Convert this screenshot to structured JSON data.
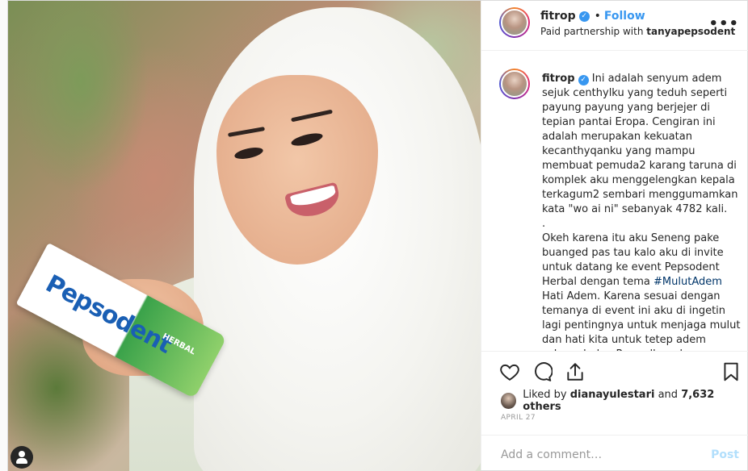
{
  "header": {
    "username": "fitrop",
    "follow_label": "Follow",
    "partnership_prefix": "Paid partnership with",
    "partner": "tanyapepsodent",
    "more_glyph": "•••"
  },
  "photo": {
    "product_brand": "Pepsodent",
    "product_variant": "HERBAL"
  },
  "caption": {
    "username": "fitrop",
    "text_1": "Ini adalah senyum adem sejuk centhylku yang teduh seperti payung payung yang berjejer di tepian pantai Eropa. Cengiran ini adalah merupakan kekuatan kecanthyqanku yang mampu membuat pemuda2 karang taruna di komplek aku menggelengkan kepala terkagum2 sembari menggumamkan kata \"wo ai ni\" sebanyak 4782 kali.\n.\nOkeh karena itu aku Seneng pake buanged pas tau kalo aku di invite untuk datang ke event Pepsodent Herbal dengan tema ",
    "hashtag": "#MulutAdem",
    "text_2": " Hati Adem. Karena sesuai dengan temanya di event ini aku di ingetin lagi pentingnya untuk menjaga mulut dan hati kita untuk tetep adem selama bulan Ramadhan dengan"
  },
  "likes": {
    "prefix": "Liked by",
    "user": "dianayulestari",
    "connector": "and",
    "others": "7,632 others"
  },
  "date": "APRIL 27",
  "comment": {
    "placeholder": "Add a comment…",
    "post_label": "Post"
  },
  "colors": {
    "link_blue": "#3897f0",
    "hashtag": "#003569",
    "post_disabled": "#b2dffc"
  },
  "icons": [
    "verified-badge-icon",
    "more-options-icon",
    "heart-icon",
    "comment-icon",
    "share-icon",
    "bookmark-icon",
    "user-tag-icon"
  ]
}
